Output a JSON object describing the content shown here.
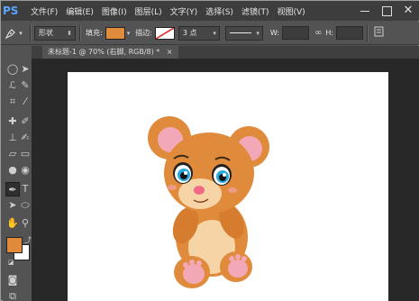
{
  "app": {
    "logo": "PS"
  },
  "menubar": {
    "items": [
      "文件(F)",
      "编辑(E)",
      "图像(I)",
      "图层(L)",
      "文字(Y)",
      "选择(S)",
      "滤镜(T)",
      "视图(V)"
    ]
  },
  "options": {
    "mode_value": "形状",
    "fill_label": "填充:",
    "stroke_label": "描边:",
    "stroke_width": "3 点",
    "width_label": "W:",
    "height_label": "H:",
    "link_icon": "link-icon",
    "fill_color": "#e08a3c"
  },
  "document": {
    "tab_title": "未标题-1 @ 70% (右脚, RGB/8) *",
    "tab_close": "×"
  },
  "colors": {
    "foreground": "#e08a3c",
    "background": "#ffffff",
    "bear_body": "#e08a3c",
    "bear_light": "#f6d4a6",
    "bear_pink": "#f3a8b8",
    "bear_eye": "#2aa9df",
    "bear_nose": "#f06a86"
  },
  "image": {
    "subject": "bear-illustration"
  }
}
